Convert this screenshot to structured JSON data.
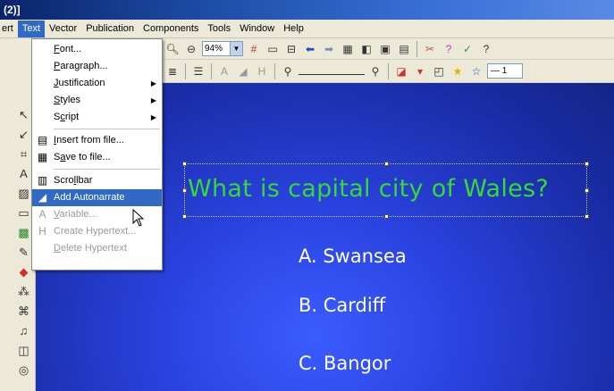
{
  "window": {
    "title": "(2)]"
  },
  "menubar": {
    "items": [
      {
        "label": "ert"
      },
      {
        "label": "Text"
      },
      {
        "label": "Vector"
      },
      {
        "label": "Publication"
      },
      {
        "label": "Components"
      },
      {
        "label": "Tools"
      },
      {
        "label": "Window"
      },
      {
        "label": "Help"
      }
    ]
  },
  "toolbar1": {
    "zoom_value": "94%"
  },
  "toolbar2": {
    "line_thickness": "1"
  },
  "text_menu": {
    "items": [
      {
        "label": "Font...",
        "accel": "F"
      },
      {
        "label": "Paragraph...",
        "accel": "P"
      },
      {
        "label": "Justification",
        "accel": "J"
      },
      {
        "label": "Styles",
        "accel": "S"
      },
      {
        "label": "Script",
        "accel": "c"
      },
      {
        "label": "Insert from file...",
        "accel": "I",
        "icon": "insert-file-icon"
      },
      {
        "label": "Save to file...",
        "accel": "a",
        "icon": "save-disk-icon"
      },
      {
        "label": "Scrollbar",
        "accel": "l",
        "icon": "scrollbar-icon"
      },
      {
        "label": "Add Autonarrate",
        "icon": "autonarrate-icon"
      },
      {
        "label": "Variable...",
        "accel": "V",
        "icon": "variable-icon"
      },
      {
        "label": "Create Hypertext...",
        "icon": "hypertext-icon"
      },
      {
        "label": "Delete Hypertext",
        "accel": "D"
      }
    ]
  },
  "slide": {
    "question": "What is capital city of Wales?",
    "answers": [
      "A. Swansea",
      "B. Cardiff",
      "C. Bangor"
    ]
  },
  "colors": {
    "question_text": "#36d936",
    "answer_text": "#ffffff",
    "slide_bg": "#1a2ca6",
    "menu_highlight": "#316ac5"
  }
}
